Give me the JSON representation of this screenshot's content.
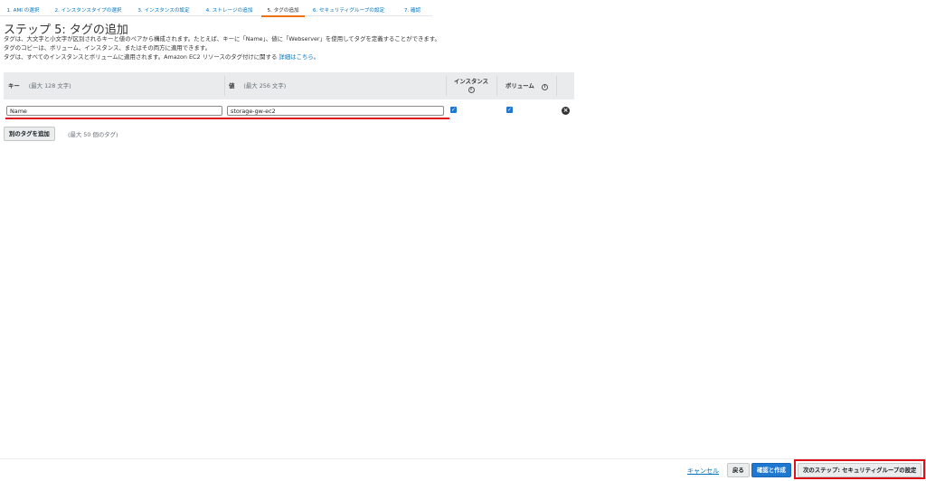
{
  "wizard": {
    "steps": [
      {
        "label": "1. AMI の選択"
      },
      {
        "label": "2. インスタンスタイプの選択"
      },
      {
        "label": "3. インスタンスの設定"
      },
      {
        "label": "4. ストレージの追加"
      },
      {
        "label": "5. タグの追加"
      },
      {
        "label": "6. セキュリティグループの設定"
      },
      {
        "label": "7. 確認"
      }
    ],
    "active_index": 4
  },
  "page": {
    "title": "ステップ 5: タグの追加",
    "desc_line1": "タグは、大文字と小文字が区別されるキーと値のペアから構成されます。たとえば、キーに「Name」、値に「Webserver」を使用してタグを定義することができます。",
    "desc_line2": "タグのコピーは、ボリューム、インスタンス、またはその両方に適用できます。",
    "desc_line3": "タグは、すべてのインスタンスとボリュームに適用されます。Amazon EC2 リソースのタグ付けに関する",
    "desc_link": "詳細はこちら。"
  },
  "table": {
    "headers": {
      "key": "キー",
      "key_hint": "(最大 128 文字)",
      "value": "値",
      "value_hint": "(最大 256 文字)",
      "instance": "インスタンス",
      "volume": "ボリューム",
      "info_icon": "i"
    },
    "rows": [
      {
        "key": "Name",
        "value": "storage-gw-ec2",
        "instance_checked": true,
        "volume_checked": true
      }
    ]
  },
  "actions": {
    "add_tag_label": "別のタグを追加",
    "add_tag_hint": "(最大 50 個のタグ)"
  },
  "footer": {
    "cancel_label": "キャンセル",
    "back_label": "戻る",
    "review_label": "確認と作成",
    "next_label": "次のステップ: セキュリティグループの設定"
  },
  "colors": {
    "accent_blue": "#0073bb",
    "primary_button": "#1f77d0",
    "active_step": "#ec7211",
    "annotation_red": "#e0101a",
    "header_bg": "#e9ebed"
  }
}
